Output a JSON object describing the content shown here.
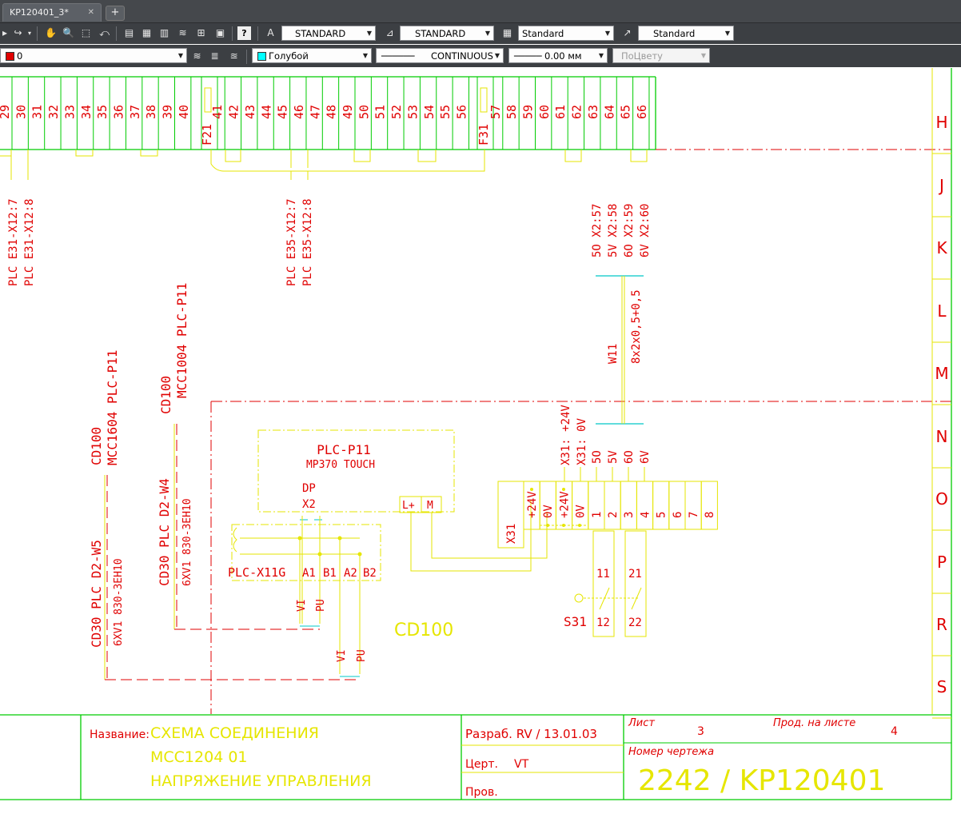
{
  "tabs": [
    {
      "label": "KP120401_3*",
      "close": "✕"
    }
  ],
  "tab_add": "+",
  "toolbar1": {
    "text_style": "STANDARD",
    "dim_style": "STANDARD",
    "table_style": "Standard",
    "mleader_style": "Standard"
  },
  "toolbar2": {
    "layer": "0",
    "color": "Голубой",
    "linetype": "CONTINUOUS",
    "lineweight": "0.00 мм",
    "plot_style": "ПоЦвету"
  },
  "colors": {
    "layer": "#e00000",
    "color": "#00ffff",
    "green": "#00cc00",
    "red": "#e00000",
    "yellow": "#e6e600",
    "cyan": "#00c8c8"
  },
  "drawing": {
    "terminal_numbers": [
      "29",
      "30",
      "31",
      "32",
      "33",
      "34",
      "35",
      "36",
      "37",
      "38",
      "39",
      "40",
      "41",
      "42",
      "43",
      "44",
      "45",
      "46",
      "47",
      "48",
      "49",
      "50",
      "51",
      "52",
      "53",
      "54",
      "55",
      "56",
      "57",
      "58",
      "59",
      "60",
      "61",
      "62",
      "63",
      "64",
      "65",
      "66"
    ],
    "fuses": [
      "F21",
      "F31"
    ],
    "grid_rows": [
      "H",
      "J",
      "K",
      "L",
      "M",
      "N",
      "O",
      "P",
      "R",
      "S"
    ],
    "refs_e31": [
      "PLC E31-X12:7",
      "PLC E31-X12:8"
    ],
    "refs_e35": [
      "PLC E35-X12:7",
      "PLC E35-X12:8"
    ],
    "refs_x2": [
      "5O  X2:57",
      "5V  X2:58",
      "6O  X2:59",
      "6V  X2:60"
    ],
    "cable_w11": "W11",
    "cable_w11_type": "8x2x0,5+0,5",
    "cable_left": {
      "id": "CD30 PLC D2-W5",
      "type": "6XV1 830-3EH10",
      "dest": "CD100",
      "dest_detail": "MCC1604 PLC-P11"
    },
    "cable_mid": {
      "id": "CD30 PLC D2-W4",
      "type": "6XV1 830-3EH10",
      "dest": "CD100",
      "dest_detail": "MCC1004 PLC-P11"
    },
    "plc_title": "PLC-P11",
    "plc_subtitle": "MP370 TOUCH",
    "dp": "DP",
    "x2": "X2",
    "lplus": "L+",
    "m": "M",
    "connector": "PLC-X11G",
    "pins": [
      "A1",
      "B1",
      "A2",
      "B2"
    ],
    "wire_vi": "VI",
    "wire_pu": "PU",
    "x31_labels": [
      "X31: +24V",
      "X31: 0V",
      "5O",
      "5V",
      "6O",
      "6V"
    ],
    "x31": "X31",
    "x31_terms": [
      "+24V",
      "0V",
      "+24V",
      "0V",
      "1",
      "2",
      "3",
      "4",
      "5",
      "6",
      "7",
      "8"
    ],
    "switch": "S31",
    "switch_contacts": [
      "11",
      "21",
      "12",
      "22"
    ],
    "area": "CD100"
  },
  "titleblock": {
    "name_label": "Название:",
    "name_lines": [
      "СХЕМА СОЕДИНЕНИЯ",
      "MCC1204 01",
      "НАПРЯЖЕНИЕ УПРАВЛЕНИЯ"
    ],
    "developed": "Разраб. RV  /  13.01.03",
    "checked_label": "Церт.",
    "checked_value": "VT",
    "approved": "Пров.",
    "sheet_label": "Лист",
    "sheet_value": "3",
    "cont_label": "Прод. на листе",
    "cont_value": "4",
    "number_label": "Номер чертежа",
    "number_value": "2242  /  KP120401"
  }
}
